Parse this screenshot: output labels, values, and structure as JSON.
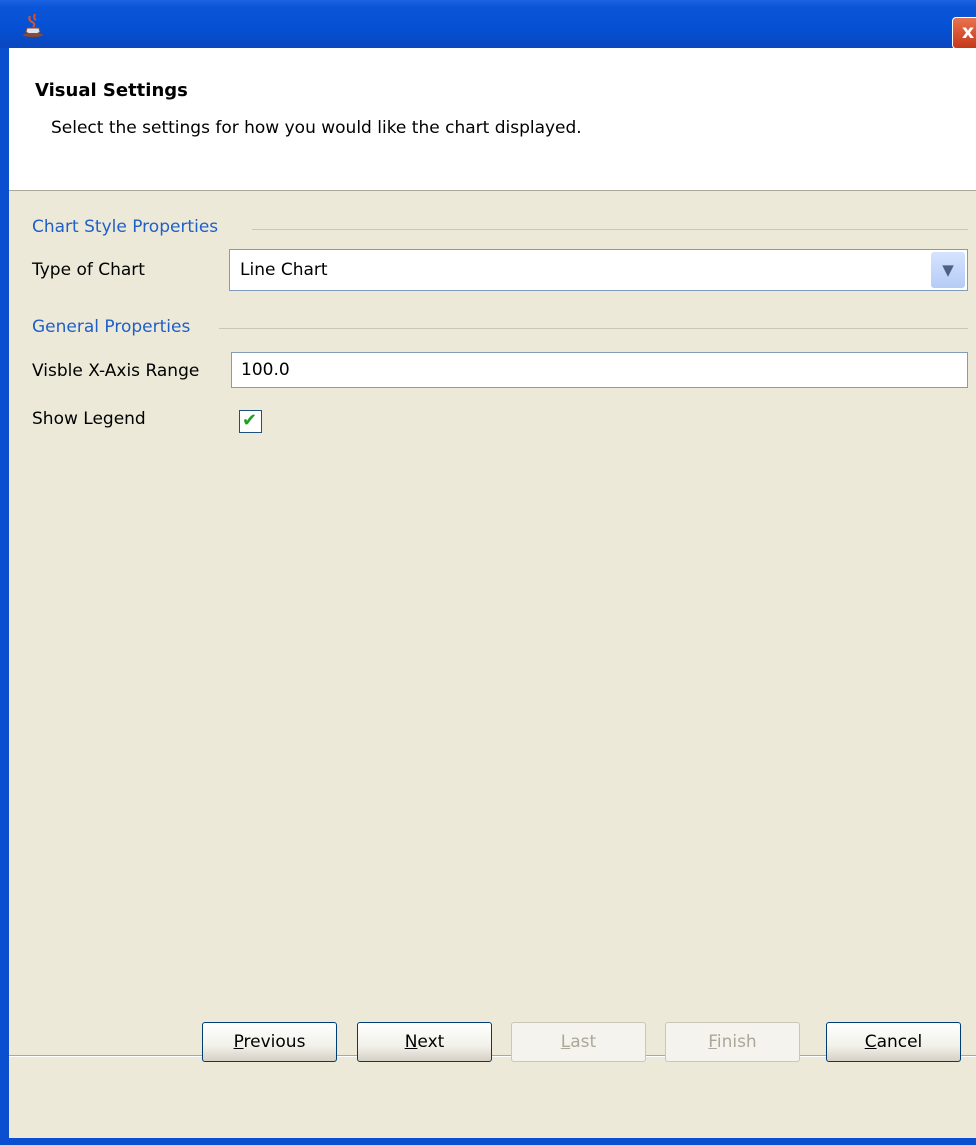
{
  "window": {
    "title": "",
    "close_label": "x"
  },
  "header": {
    "title": "Visual Settings",
    "description": "Select the settings for how you would like the chart displayed."
  },
  "sections": {
    "chart_style": "Chart Style Properties",
    "general": "General Properties"
  },
  "fields": {
    "type_of_chart": {
      "label": "Type of Chart",
      "value": "Line Chart"
    },
    "x_axis_range": {
      "label": "Visble X-Axis Range",
      "value": "100.0"
    },
    "show_legend": {
      "label": "Show Legend",
      "checked": true
    }
  },
  "buttons": {
    "previous": {
      "label": "Previous",
      "mnemonic": "P",
      "rest": "revious",
      "enabled": true
    },
    "next": {
      "label": "Next",
      "mnemonic": "N",
      "rest": "ext",
      "enabled": true
    },
    "last": {
      "label": "Last",
      "mnemonic": "L",
      "rest": "ast",
      "enabled": false
    },
    "finish": {
      "label": "Finish",
      "mnemonic": "F",
      "rest": "inish",
      "enabled": false
    },
    "cancel": {
      "label": "Cancel",
      "mnemonic": "C",
      "rest": "ancel",
      "enabled": true
    }
  },
  "icons": {
    "app": "java-coffee-icon",
    "close": "close-icon",
    "dropdown": "chevron-down-icon",
    "check": "checkmark-icon"
  },
  "colors": {
    "titlebar": "#0550D2",
    "section_heading": "#1F5FC8",
    "background": "#ECE9D8",
    "checkmark": "#21A121"
  }
}
